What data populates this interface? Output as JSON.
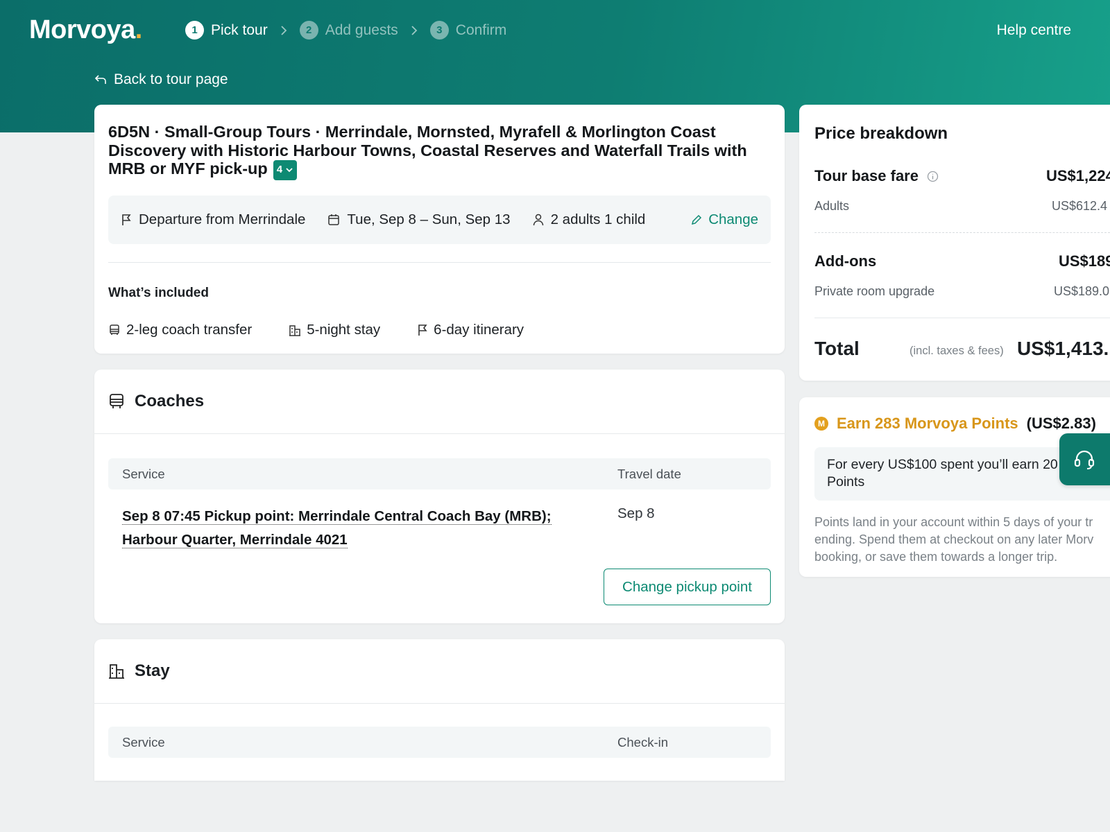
{
  "header": {
    "logo": "Morvoya",
    "logo_dot": ".",
    "steps": [
      {
        "num": "1",
        "label": "Pick tour"
      },
      {
        "num": "2",
        "label": "Add guests"
      },
      {
        "num": "3",
        "label": "Confirm"
      }
    ],
    "help": "Help centre",
    "back": "Back to tour page"
  },
  "tour": {
    "title": "6D5N · Small-Group Tours · Merrindale, Mornsted, Myrafell & Morlington Coast Discovery with Historic Harbour Towns, Coastal Reserves and Waterfall Trails with MRB or MYF pick-up",
    "badge": "4",
    "departure": "Departure from Merrindale",
    "dates": "Tue, Sep 8 – Sun, Sep 13",
    "guests": "2 adults 1 child",
    "change": "Change",
    "included_title": "What’s included",
    "included": [
      "2-leg coach transfer",
      "5-night stay",
      "6-day itinerary"
    ]
  },
  "coaches": {
    "title": "Coaches",
    "col_service": "Service",
    "col_date": "Travel date",
    "service_line1": "Sep 8 07:45 Pickup point: Merrindale Central Coach Bay (MRB);",
    "service_line2": "Harbour Quarter, Merrindale 4021",
    "travel_date": "Sep 8",
    "button": "Change pickup point"
  },
  "stay": {
    "title": "Stay",
    "col_service": "Service",
    "col_checkin": "Check-in"
  },
  "price": {
    "title": "Price breakdown",
    "base_label": "Tour base fare",
    "base_value": "US$1,224",
    "adults_label": "Adults",
    "adults_value": "US$612.4",
    "addons_label": "Add-ons",
    "addons_value": "US$189",
    "addon_item": "Private room upgrade",
    "addon_item_value": "US$189.0",
    "total_label": "Total",
    "total_note": "(incl. taxes & fees)",
    "total_value": "US$1,413."
  },
  "points": {
    "coin": "M",
    "earn": "Earn 283 Morvoya Points",
    "usd": "(US$2.83)",
    "box_line1": "For every US$100 spent you’ll earn 20",
    "box_line2": "Points",
    "fine1": "Points land in your account within 5 days of your tr",
    "fine2": "ending. Spend them at checkout on any later Morv",
    "fine3": "booking, or save them towards a longer trip."
  },
  "colors": {
    "brand": "#0d7a70",
    "accent": "#0d8a73",
    "gold": "#d8961a"
  }
}
